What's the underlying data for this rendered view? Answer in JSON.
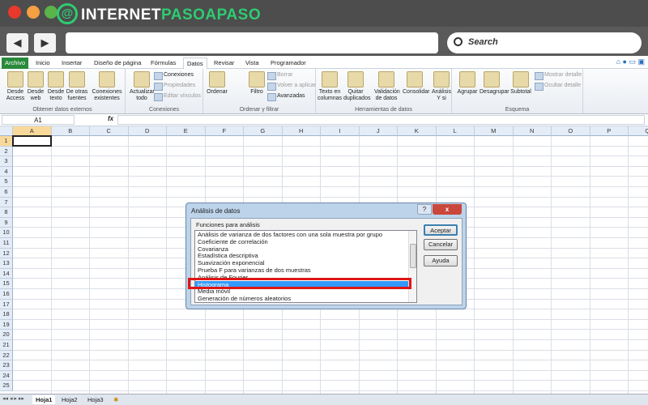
{
  "browser": {
    "brand_part1": "INTERNET",
    "brand_part2": "PASOAPASO",
    "logo_letter": "@",
    "search_label": "Search",
    "back_icon": "◀",
    "forward_icon": "▶",
    "colors": {
      "close": "#e8392c",
      "minimize": "#f5a043",
      "maximize": "#5bb34a",
      "brand_green": "#2ecc71"
    }
  },
  "ribbon": {
    "tabs": [
      "Archivo",
      "Inicio",
      "Insertar",
      "Diseño de página",
      "Fórmulas",
      "Datos",
      "Revisar",
      "Vista",
      "Programador"
    ],
    "active_tab": "Datos",
    "groups": [
      {
        "label": "Obtener datos externos",
        "buttons": [
          "Desde Access",
          "Desde web",
          "Desde texto",
          "De otras fuentes",
          "Conexiones existentes"
        ]
      },
      {
        "label": "Conexiones",
        "buttons": [
          "Actualizar todo"
        ],
        "small": [
          "Conexiones",
          "Propiedades",
          "Editar vínculos"
        ]
      },
      {
        "label": "Ordenar y filtrar",
        "buttons": [
          "Ordenar",
          "Filtro"
        ],
        "small": [
          "Borrar",
          "Volver a aplicar",
          "Avanzadas"
        ]
      },
      {
        "label": "Herramientas de datos",
        "buttons": [
          "Texto en columnas",
          "Quitar duplicados",
          "Validación de datos",
          "Consolidar",
          "Análisis Y si"
        ]
      },
      {
        "label": "Esquema",
        "buttons": [
          "Agrupar",
          "Desagrupar",
          "Subtotal"
        ],
        "small": [
          "Mostrar detalle",
          "Ocultar detalle"
        ]
      }
    ]
  },
  "formula_bar": {
    "name_box": "A1",
    "fx": "fx",
    "value": ""
  },
  "sheet": {
    "columns": [
      "A",
      "B",
      "C",
      "D",
      "E",
      "F",
      "G",
      "H",
      "I",
      "J",
      "K",
      "L",
      "M",
      "N",
      "O",
      "P",
      "Q"
    ],
    "rows": [
      "1",
      "2",
      "3",
      "4",
      "5",
      "6",
      "7",
      "8",
      "9",
      "10",
      "11",
      "12",
      "13",
      "14",
      "15",
      "16",
      "17",
      "18",
      "19",
      "20",
      "21",
      "22",
      "23",
      "24",
      "25"
    ],
    "selected_cell": "A1",
    "tabs": [
      "Hoja1",
      "Hoja2",
      "Hoja3"
    ],
    "active_tab": "Hoja1"
  },
  "dialog": {
    "title": "Análisis de datos",
    "list_label": "Funciones para análisis",
    "items": [
      "Análisis de varianza de dos factores con una sola muestra por grupo",
      "Coeficiente de correlación",
      "Covarianza",
      "Estadística descriptiva",
      "Suavización exponencial",
      "Prueba F para varianzas de dos muestras",
      "Análisis de Fourier",
      "Histograma",
      "Media móvil",
      "Generación de números aleatorios"
    ],
    "selected": "Histograma",
    "buttons": {
      "ok": "Aceptar",
      "cancel": "Cancelar",
      "help": "Ayuda"
    },
    "help_icon": "?",
    "close_icon": "x",
    "highlight_color": "#e01515"
  }
}
